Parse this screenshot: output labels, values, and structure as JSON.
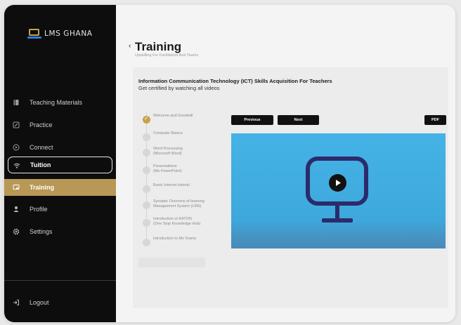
{
  "brand": {
    "name": "LMS GHANA",
    "gold": "#b79856",
    "sidebar_bg": "#0d0d0d",
    "video_blue": "#44b3e6"
  },
  "sidebar": {
    "items": [
      {
        "label": "Teaching Materials",
        "icon": "book-icon"
      },
      {
        "label": "Practice",
        "icon": "edit-icon"
      },
      {
        "label": "Connect",
        "icon": "play-circle-icon"
      },
      {
        "label": "Tuition",
        "icon": "wifi-icon",
        "state": "outlined"
      },
      {
        "label": "Training",
        "icon": "certificate-icon",
        "state": "active"
      },
      {
        "label": "Profile",
        "icon": "user-icon"
      },
      {
        "label": "Settings",
        "icon": "gear-icon"
      }
    ],
    "logout": {
      "label": "Logout",
      "icon": "logout-icon"
    }
  },
  "header": {
    "back_icon": "chevron-left-icon",
    "title": "Training",
    "subtitle": "Upskilling For Facilitators And Teams"
  },
  "course": {
    "title": "Information Communication Technology (ICT) Skills Acquisition For Teachers",
    "subtitle": "Get certified by watching all videos",
    "steps": [
      {
        "l1": "Welcome and Goodwill",
        "l2": "",
        "done": true
      },
      {
        "l1": "Computer Basics",
        "l2": "",
        "done": false
      },
      {
        "l1": "Word Processing",
        "l2": "(Microsoft Word)",
        "done": false
      },
      {
        "l1": "Presentations",
        "l2": "(Ms PowerPoint)",
        "done": false
      },
      {
        "l1": "Basic Internet tutorial",
        "l2": "",
        "done": false
      },
      {
        "l1": "Synoptic Overview of learning",
        "l2": "Management System (LMS)",
        "done": false
      },
      {
        "l1": "Introduction ot KATON",
        "l2": "(One Stop Knowledge Hub)",
        "done": false
      },
      {
        "l1": "Introduction to Ms Teams",
        "l2": "",
        "done": false
      }
    ],
    "controls": {
      "previous": "Previous",
      "next": "Next",
      "pdf": "PDF"
    },
    "video": {
      "icons": [
        "monitor-icon",
        "play-icon"
      ]
    }
  }
}
